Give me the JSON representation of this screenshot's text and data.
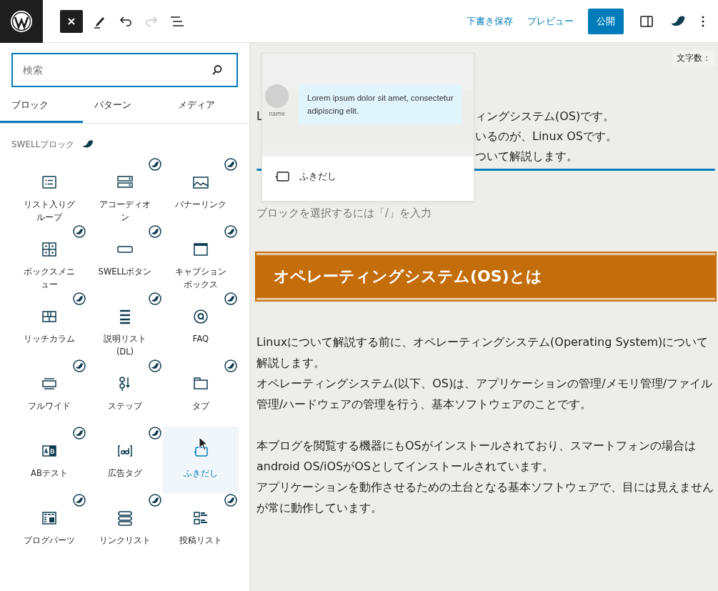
{
  "toolbar": {
    "save_draft": "下書き保存",
    "preview": "プレビュー",
    "publish": "公開"
  },
  "inserter": {
    "search": {
      "placeholder": "検索"
    },
    "tabs": [
      {
        "label": "ブロック",
        "selected": true
      },
      {
        "label": "パターン",
        "selected": false
      },
      {
        "label": "メディア",
        "selected": false
      }
    ],
    "category": "SWELLブロック",
    "blocks": [
      {
        "label": "リスト入りグループ",
        "selected": false,
        "badge": false
      },
      {
        "label": "アコーディオン",
        "selected": false,
        "badge": true
      },
      {
        "label": "バナーリンク",
        "selected": false,
        "badge": true
      },
      {
        "label": "ボックスメニュー",
        "selected": false,
        "badge": true
      },
      {
        "label": "SWELLボタン",
        "selected": false,
        "badge": true
      },
      {
        "label": "キャプションボックス",
        "selected": false,
        "badge": true
      },
      {
        "label": "リッチカラム",
        "selected": false,
        "badge": true
      },
      {
        "label": "説明リスト(DL)",
        "selected": false,
        "badge": true
      },
      {
        "label": "FAQ",
        "selected": false,
        "badge": true
      },
      {
        "label": "フルワイド",
        "selected": false,
        "badge": true
      },
      {
        "label": "ステップ",
        "selected": false,
        "badge": true
      },
      {
        "label": "タブ",
        "selected": false,
        "badge": true
      },
      {
        "label": "ABテスト",
        "selected": false,
        "badge": true
      },
      {
        "label": "広告タグ",
        "selected": false,
        "badge": true
      },
      {
        "label": "ふきだし",
        "selected": true,
        "badge": false
      },
      {
        "label": "ブログパーツ",
        "selected": false,
        "badge": true
      },
      {
        "label": "リンクリスト",
        "selected": false,
        "badge": true
      },
      {
        "label": "投稿リスト",
        "selected": false,
        "badge": true
      }
    ]
  },
  "preview_popover": {
    "avatar_name": "name",
    "bubble_text": "Lorem ipsum dolor sit amet, consectetur adipiscing elit.",
    "block_name": "ふきだし"
  },
  "editor": {
    "word_count": "文字数：",
    "partial_lines": [
      {
        "left": "L",
        "right": "ィングシステム(OS)です。"
      },
      {
        "right": "いるのが、Linux OSです。"
      },
      {
        "right": "ついて解説します。"
      }
    ],
    "placeholder": "ブロックを選択するには「/」を入力",
    "heading": "オペレーティングシステム(OS)とは",
    "paragraphs": [
      [
        "Linuxについて解説する前に、オペレーティングシステム(Operating System)について解説します。",
        "オペレーティングシステム(以下、OS)は、アプリケーションの管理/メモリ管理/ファイル管理/ハードウェアの管理を行う、基本ソフトウェアのことです。"
      ],
      [
        "本ブログを閲覧する機器にもOSがインストールされており、スマートフォンの場合はandroid OS/iOSがOSとしてインストールされています。",
        "アプリケーションを動作させるための土台となる基本ソフトウェアで、目には見えませんが常に動作しています。"
      ]
    ]
  }
}
